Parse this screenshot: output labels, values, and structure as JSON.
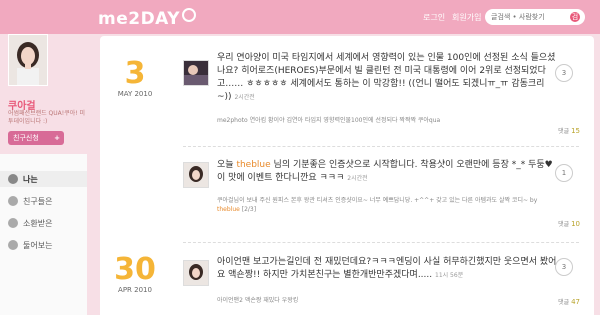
{
  "header": {
    "logo": "me2DAY",
    "links": [
      "로그인",
      "회원가입"
    ],
    "search_placeholder": "글검색 • 사람찾기",
    "search_button": "검"
  },
  "profile": {
    "name": "쿠아걸",
    "desc": "어썸패션브랜드 QUA!쿠아! 미투데이입니다 :)",
    "friend_button": "친구신청",
    "friend_plus": "+"
  },
  "nav": [
    "나는",
    "친구들은",
    "소환받은",
    "둘어보는"
  ],
  "entries": [
    {
      "day": "3",
      "month": "MAY 2010",
      "text": "우리 연아양이 미국 타임지에서 세계에서 영향력이 있는 인물 100인에 선정된 소식 들으셨나요? 히어로즈(HEROES)부문에서 빌 클린턴 전 미국 대통령에 이어 2위로 선정되었다고……  ㅎㅎㅎㅎㅎ 세계에서도 통하는 이 막강함!! ((언니 떨어도 되겠니ㅠ_ㅠ 감동크리~))",
      "time": "2시간전",
      "tags": "me2photo   연아킴 황이야 김연아 타임지 영향력인물100인에 선정되다 짝짝짝 쿠아qua",
      "count": "3",
      "comments_label": "댓글",
      "comments": "15"
    },
    {
      "text_prefix": "오늘",
      "text_user": "theblue",
      "text_rest": "님의 기분좋은 인증샷으로 시작합니다. 착용샷이 오랜만에 등장 *_* 두둥♥ 이 맛에 이벤트 한다니깐요 ㅋㅋㅋ",
      "time": "2시간전",
      "meta_line1": "쿠아걸님이 보내 주신 원피스 본후 왕관 티셔츠 인증샷이요~ 너무 예쁘답니당. +^^+ 갖고 있는 다른 아템과도 살짝 코디~ by",
      "meta_user": "theblue",
      "meta_page": "[2/3]",
      "count": "1",
      "comments_label": "댓글",
      "comments": "10"
    },
    {
      "day": "30",
      "month": "APR 2010",
      "text": "아이언맨 보고가는길인데 전 재밌던데요?ㅋㅋㅋ엔딩이 사실 허무하긴했지만 웃으면서 봤어요 액숀짱!! 하지만 가치본친구는 별한개반만주겠다며.....",
      "time": "11시 56분",
      "tags": "아이언맨2 액숀짱 재밌다 우왕킹",
      "count": "3",
      "comments_label": "댓글",
      "comments": "47"
    }
  ],
  "colors": {
    "header": "#f1a9bf",
    "accent": "#e85a7a",
    "date": "#f5b537"
  }
}
